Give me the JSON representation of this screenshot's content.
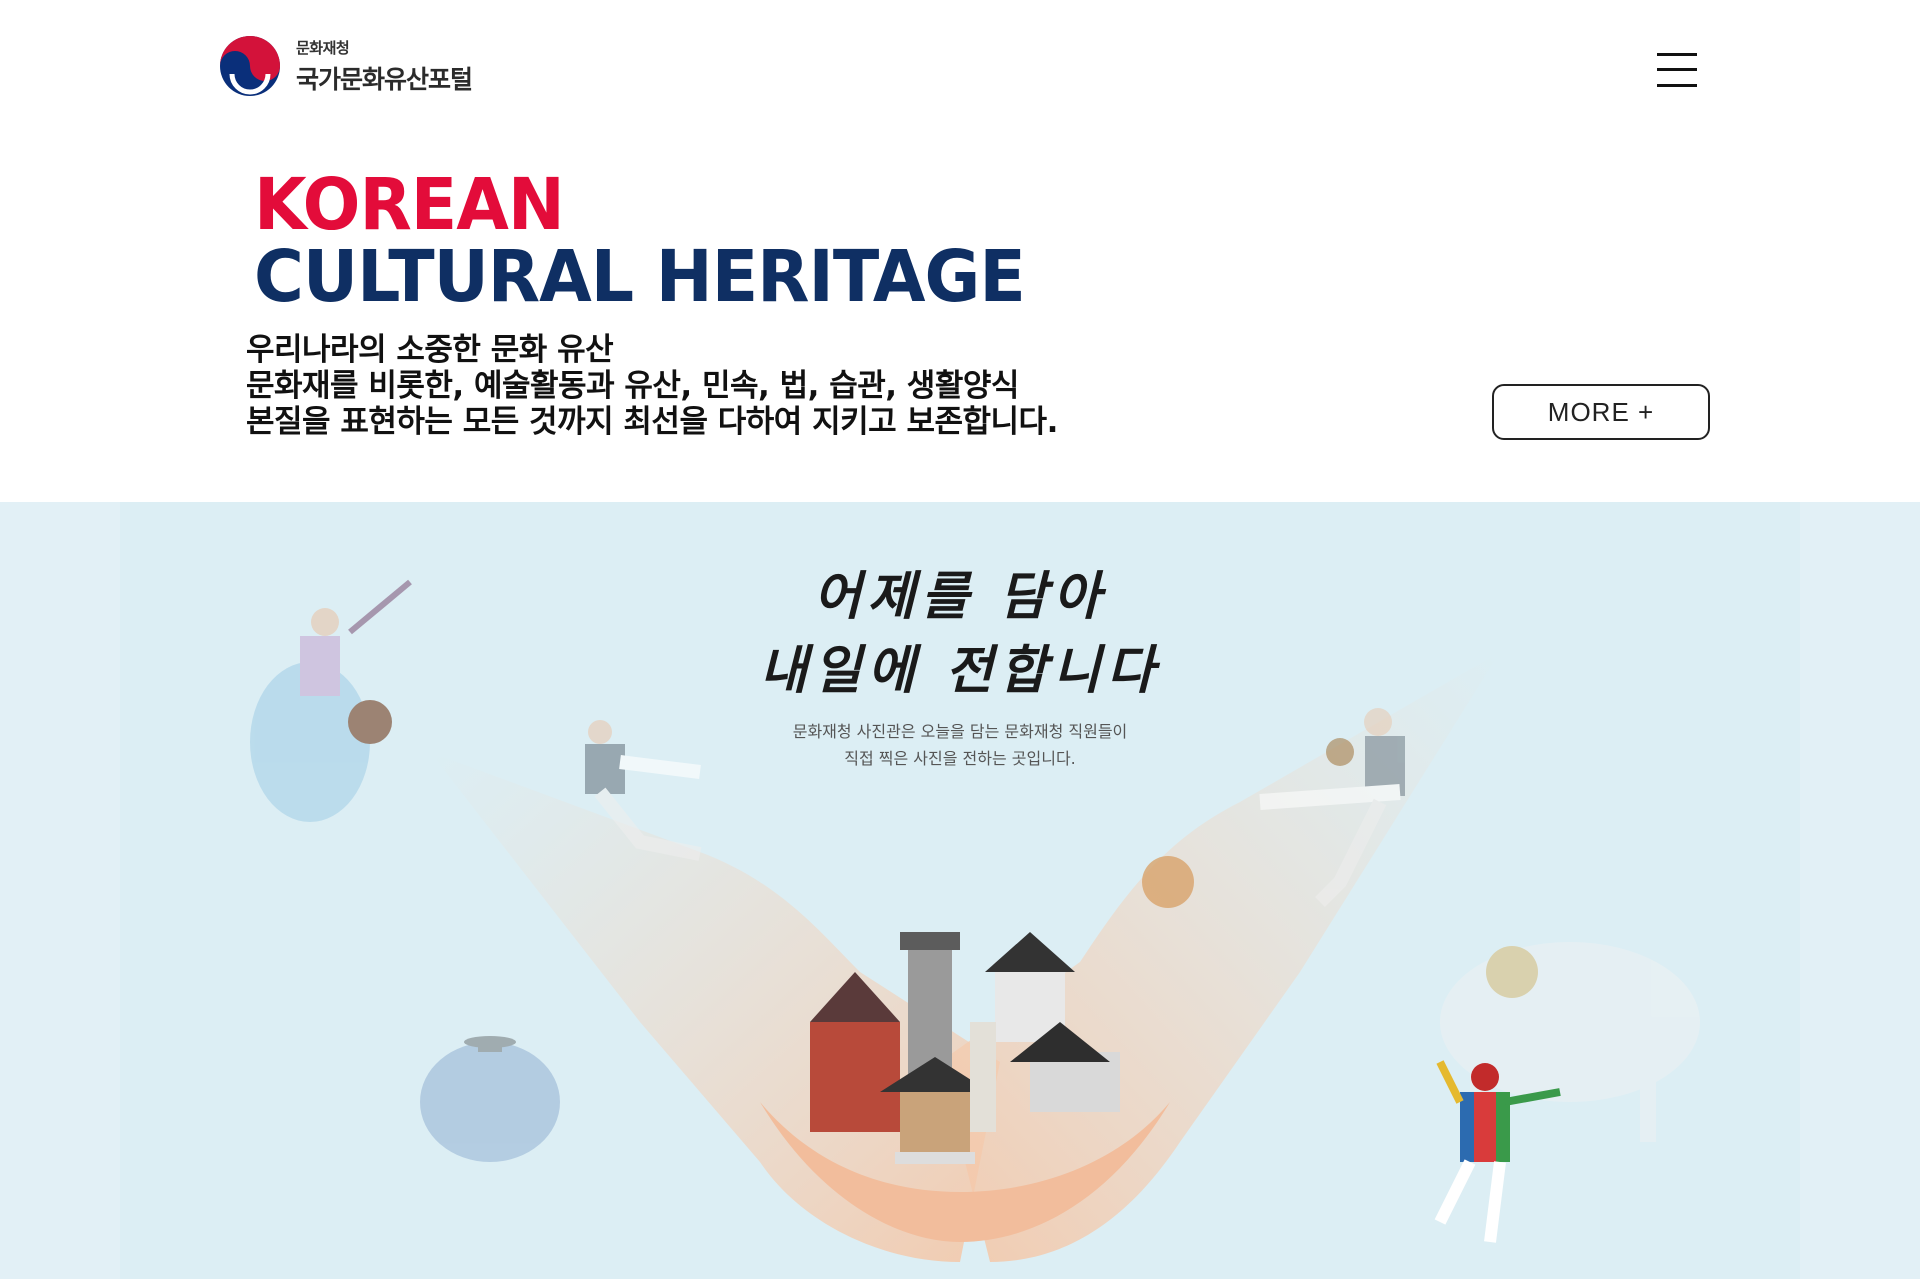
{
  "header": {
    "logo_small": "문화재청",
    "logo_main": "국가문화유산포털"
  },
  "hero": {
    "title_line1": "KOREAN",
    "title_line2": "CULTURAL HERITAGE",
    "desc_lines": [
      "우리나라의 소중한 문화 유산",
      "문화재를 비롯한, 예술활동과 유산, 민속, 법, 습관, 생활양식",
      "본질을 표현하는 모든 것까지 최선을 다하여 지키고 보존합니다."
    ],
    "more_label": "MORE +"
  },
  "banner": {
    "headline_lines": [
      "어제를 담아",
      "내일에 전합니다"
    ],
    "caption_lines": [
      "문화재청 사진관은 오늘을 담는 문화재청 직원들이",
      "직접 찍은 사진을 전하는 곳입니다."
    ]
  },
  "colors": {
    "title_red": "#e30c3a",
    "title_navy": "#0f2f63",
    "banner_bg": "#dceef4"
  },
  "icons": [
    "taegeuk-logo-icon",
    "hamburger-menu-icon"
  ]
}
